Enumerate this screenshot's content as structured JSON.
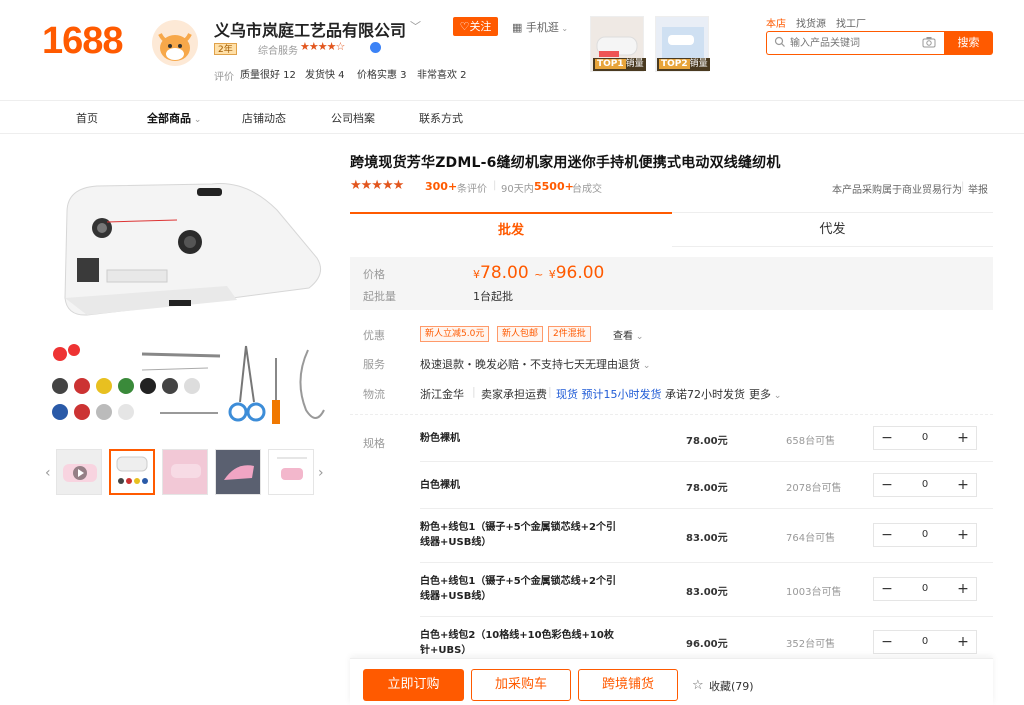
{
  "header": {
    "logo": "1688",
    "shop_name": "义乌市岚庭工艺品有限公司",
    "follow": "关注",
    "mobile": "手机逛",
    "years_badge": "2年",
    "service_label": "综合服务",
    "stars": "★★★★☆",
    "rating_label": "评价",
    "rating_tags": [
      "质量很好 12",
      "发货快 4",
      "价格实惠 3",
      "非常喜欢 2"
    ],
    "top_labels": [
      {
        "rank": "TOP1",
        "text": "销量"
      },
      {
        "rank": "TOP2",
        "text": "销量"
      }
    ]
  },
  "search": {
    "tabs": [
      "本店",
      "找货源",
      "找工厂"
    ],
    "placeholder": "输入产品关键词",
    "button": "搜索"
  },
  "nav": {
    "items": [
      "首页",
      "全部商品",
      "店铺动态",
      "公司档案",
      "联系方式"
    ]
  },
  "product": {
    "title": "跨境现货芳华ZDML-6缝纫机家用迷你手持机便携式电动双线缝纫机",
    "stars": "★★★★★",
    "review_count": "300+",
    "review_text": "条评价",
    "days_label": "90天内",
    "sold_count": "5500+",
    "sold_text": "台成交",
    "b2b_note": "本产品采购属于商业贸易行为",
    "report": "举报"
  },
  "tabs": {
    "wholesale": "批发",
    "dropship": "代发"
  },
  "price": {
    "label": "价格",
    "currency": "¥",
    "low": "78.00",
    "tilde": "~",
    "high": "96.00",
    "moq_label": "起批量",
    "moq_value": "1台起批"
  },
  "promo": {
    "label": "优惠",
    "tags": [
      "新人立减5.0元",
      "新人包邮",
      "2件混批"
    ],
    "more": "查看"
  },
  "service": {
    "label": "服务",
    "value": "极速退款・晚发必赔・不支持七天无理由退货"
  },
  "logistics": {
    "label": "物流",
    "origin": "浙江金华",
    "fee": "卖家承担运费",
    "stock": "现货 预计15小时发货",
    "promise": "承诺72小时发货",
    "more": "更多"
  },
  "spec": {
    "label": "规格",
    "rows": [
      {
        "name": "粉色裸机",
        "price": "78.00元",
        "stock": "658台可售",
        "qty": "0"
      },
      {
        "name": "白色裸机",
        "price": "78.00元",
        "stock": "2078台可售",
        "qty": "0"
      },
      {
        "name": "粉色+线包1（镊子+5个金属锁芯线+2个引线器+USB线）",
        "price": "83.00元",
        "stock": "764台可售",
        "qty": "0"
      },
      {
        "name": "白色+线包1（镊子+5个金属锁芯线+2个引线器+USB线）",
        "price": "83.00元",
        "stock": "1003台可售",
        "qty": "0"
      },
      {
        "name": "白色+线包2（10格线+10色彩色线+10枚针+UBS）",
        "price": "96.00元",
        "stock": "352台可售",
        "qty": "0"
      }
    ]
  },
  "actions": {
    "buy": "立即订购",
    "cart": "加采购车",
    "crossborder": "跨境铺货",
    "favorite": "收藏(79)"
  },
  "colors": {
    "accent": "#ff5a00",
    "link_blue": "#1f5bd6"
  }
}
